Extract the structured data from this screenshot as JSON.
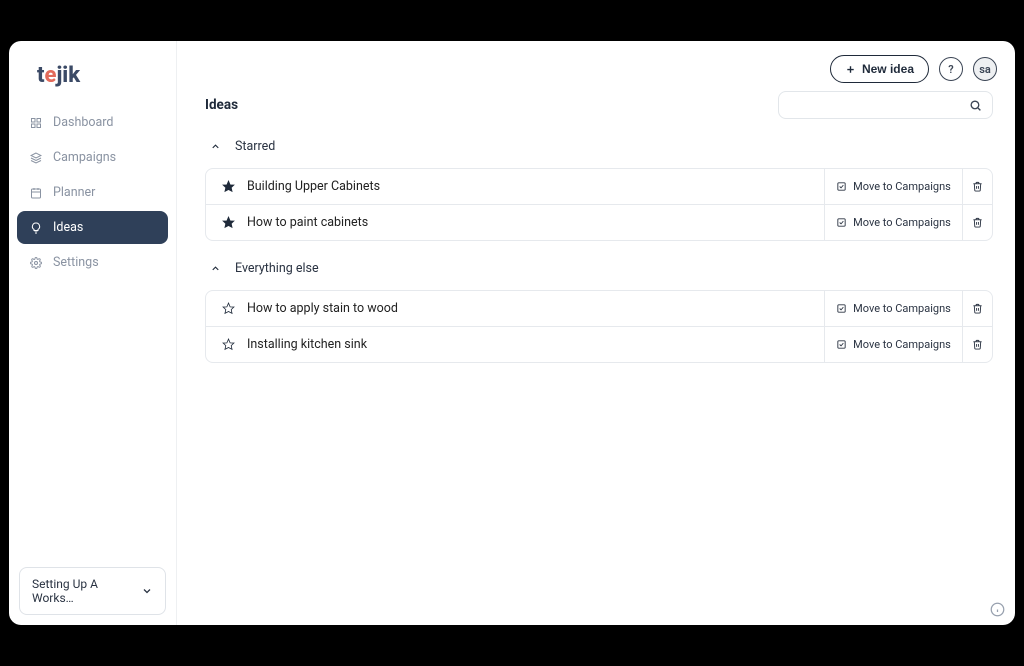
{
  "brand": "tejik",
  "sidebar": {
    "items": [
      {
        "label": "Dashboard"
      },
      {
        "label": "Campaigns"
      },
      {
        "label": "Planner"
      },
      {
        "label": "Ideas"
      },
      {
        "label": "Settings"
      }
    ],
    "workspace_label": "Setting Up A Works…"
  },
  "topbar": {
    "new_idea_label": "New idea",
    "help_symbol": "?",
    "avatar_initials": "sa"
  },
  "page": {
    "title": "Ideas",
    "search_placeholder": ""
  },
  "groups": [
    {
      "title": "Starred",
      "rows": [
        {
          "starred": true,
          "title": "Building Upper Cabinets",
          "move_label": "Move to Campaigns"
        },
        {
          "starred": true,
          "title": "How to paint cabinets",
          "move_label": "Move to Campaigns"
        }
      ]
    },
    {
      "title": "Everything else",
      "rows": [
        {
          "starred": false,
          "title": "How to apply stain to wood",
          "move_label": "Move to Campaigns"
        },
        {
          "starred": false,
          "title": "Installing kitchen sink",
          "move_label": "Move to Campaigns"
        }
      ]
    }
  ]
}
